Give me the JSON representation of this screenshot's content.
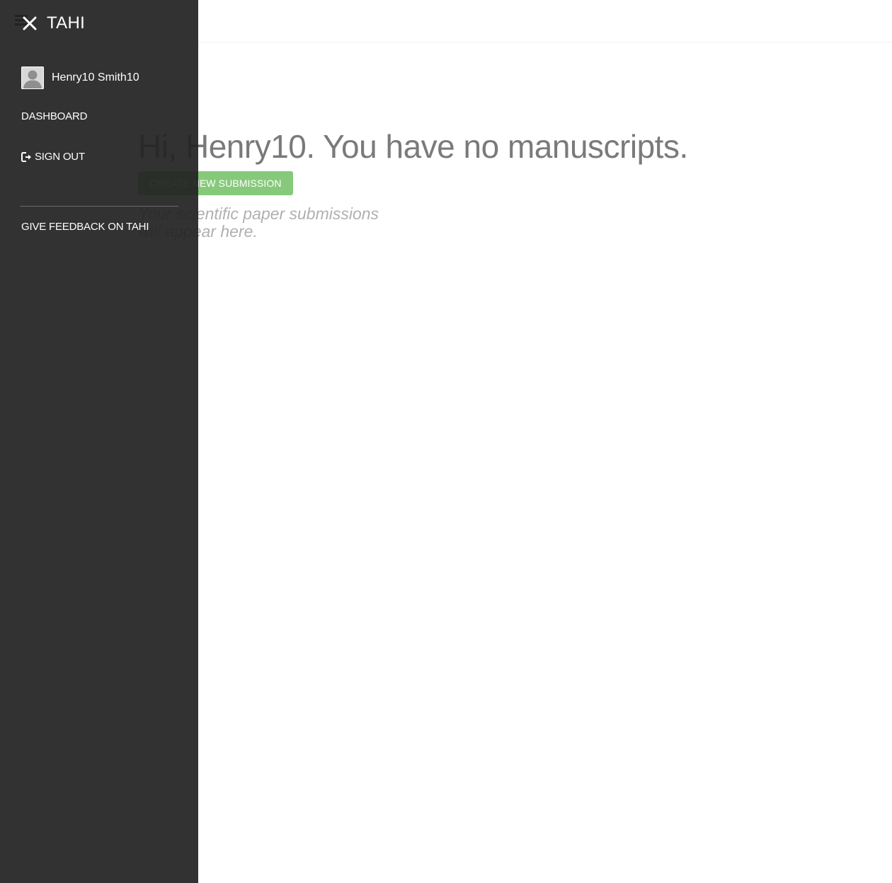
{
  "app": {
    "brand": "TAHI"
  },
  "drawer": {
    "user_name": "Henry10 Smith10",
    "dashboard_label": "DASHBOARD",
    "signout_label": "SIGN OUT",
    "feedback_label": "GIVE FEEDBACK ON TAHI"
  },
  "dashboard": {
    "greeting": "Hi, Henry10. You have no manuscripts.",
    "create_button_label": "CREATE NEW SUBMISSION",
    "empty_note": "Your scientific paper submissions will appear here."
  },
  "colors": {
    "drawer_background": "#222222",
    "accent_green": "#87c97b",
    "greeting_text": "#7a7a7a"
  }
}
